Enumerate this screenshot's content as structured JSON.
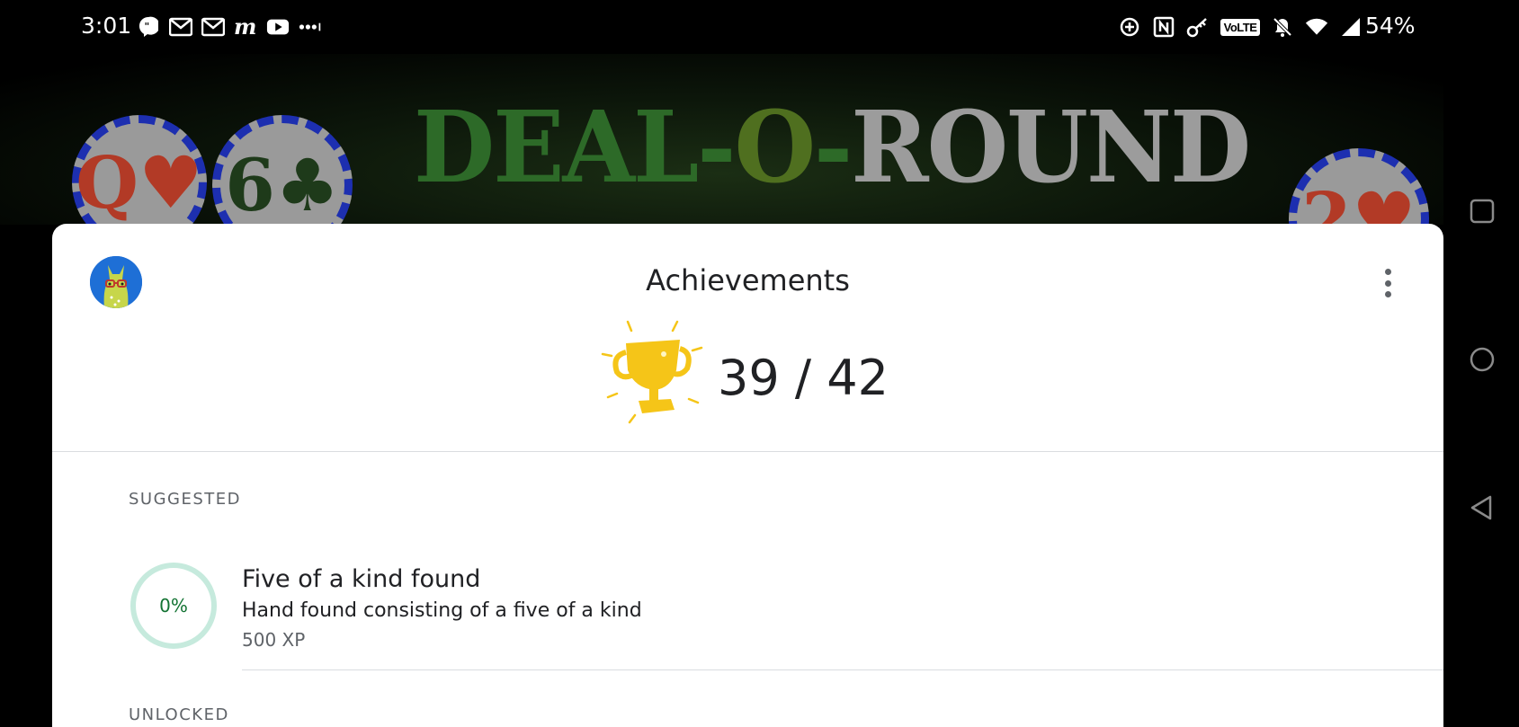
{
  "status_bar": {
    "time": "3:01",
    "battery": "54%",
    "volte_label": "VoLTE",
    "left_icons": [
      "chat-icon",
      "gmail-icon",
      "gmail-icon",
      "messenger-icon",
      "youtube-icon",
      "more-dots-icon"
    ],
    "right_icons": [
      "data-saver-icon",
      "nfc-icon",
      "vpn-key-icon",
      "volte-icon",
      "bell-off-icon",
      "wifi-icon",
      "signal-icon"
    ]
  },
  "game": {
    "title_parts": [
      "DEAL",
      "-",
      "O",
      "-",
      "ROUND"
    ],
    "chips": [
      "Q♥",
      "6♣",
      "2♥"
    ],
    "colors": {
      "green_dark": "#2d6a28",
      "green_olive": "#4f6f1f",
      "grey": "#9c9c9c",
      "chip_blue": "#1d2fb0",
      "heart_red": "#b23a26"
    }
  },
  "sheet": {
    "title": "Achievements",
    "progress": {
      "unlocked": 39,
      "total": 42,
      "label": "39 / 42"
    },
    "sections": {
      "suggested": "SUGGESTED",
      "unlocked": "UNLOCKED"
    },
    "suggested_item": {
      "percent_label": "0%",
      "percent": 0,
      "title": "Five of a kind found",
      "description": "Hand found consisting of a five of a kind",
      "xp": "500 XP"
    },
    "colors": {
      "trophy": "#f5c518",
      "ring_track": "#c6eadd",
      "ring_text": "#137333"
    }
  },
  "nav": {
    "buttons": [
      "recents-square-icon",
      "home-circle-icon",
      "back-triangle-icon"
    ]
  }
}
